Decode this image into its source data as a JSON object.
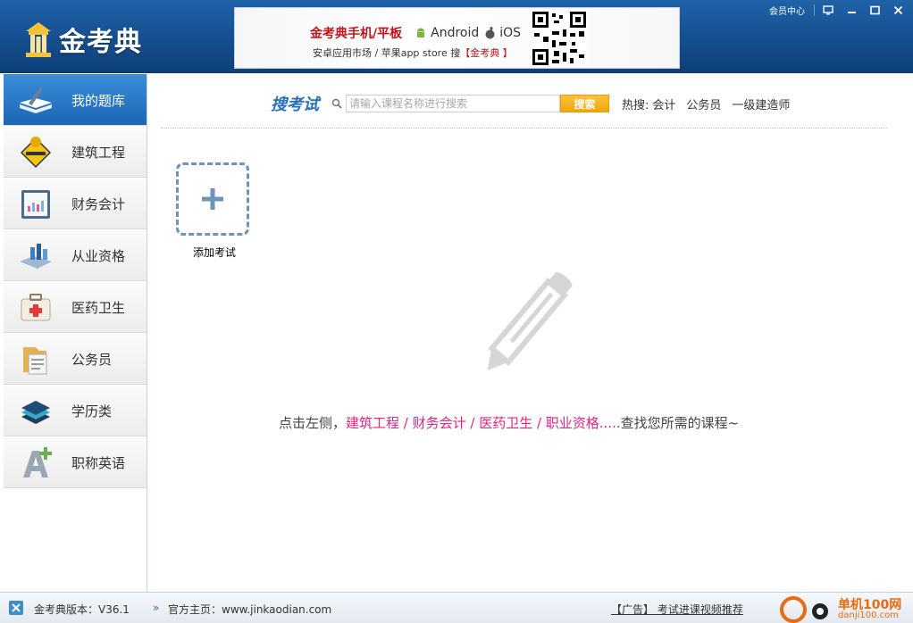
{
  "header": {
    "app_name": "金考典",
    "member_center": "会员中心",
    "banner": {
      "title": "金考典手机/平板",
      "android": "Android",
      "ios": "iOS",
      "subtitle_prefix": "安卓应用市场 / 苹果app store 搜",
      "subtitle_brand": "【金考典 】"
    }
  },
  "sidebar": {
    "items": [
      {
        "label": "我的题库",
        "icon": "book-pen-icon",
        "active": true
      },
      {
        "label": "建筑工程",
        "icon": "construction-sign-icon"
      },
      {
        "label": "财务会计",
        "icon": "clipboard-chart-icon"
      },
      {
        "label": "从业资格",
        "icon": "bar-chart-book-icon"
      },
      {
        "label": "医药卫生",
        "icon": "medical-kit-icon"
      },
      {
        "label": "公务员",
        "icon": "folder-document-icon"
      },
      {
        "label": "学历类",
        "icon": "layers-icon"
      },
      {
        "label": "职称英语",
        "icon": "letter-a-plus-icon"
      }
    ]
  },
  "search": {
    "title": "搜考试",
    "placeholder": "请输入课程名称进行搜索",
    "button": "搜索",
    "hot_label": "热搜:",
    "hot_links": [
      "会计",
      "公务员",
      "一级建造师"
    ]
  },
  "main": {
    "add_exam_label": "添加考试",
    "hint_prefix": "点击左侧，",
    "hint_categories": "建筑工程 / 财务会计 / 医药卫生 / 职业资格.....",
    "hint_suffix": "查找您所需的课程~"
  },
  "statusbar": {
    "version": "金考典版本：V36.1",
    "homepage": "官方主页：www.jinkaodian.com",
    "ad": "【广告】 考试进课视频推荐",
    "watermark": "单机100网",
    "watermark_sub": "danji100.com"
  },
  "colors": {
    "header_blue": "#154f8f",
    "accent_pink": "#e2257e",
    "search_button": "#f2a60d",
    "active_item": "#1b66b5"
  }
}
